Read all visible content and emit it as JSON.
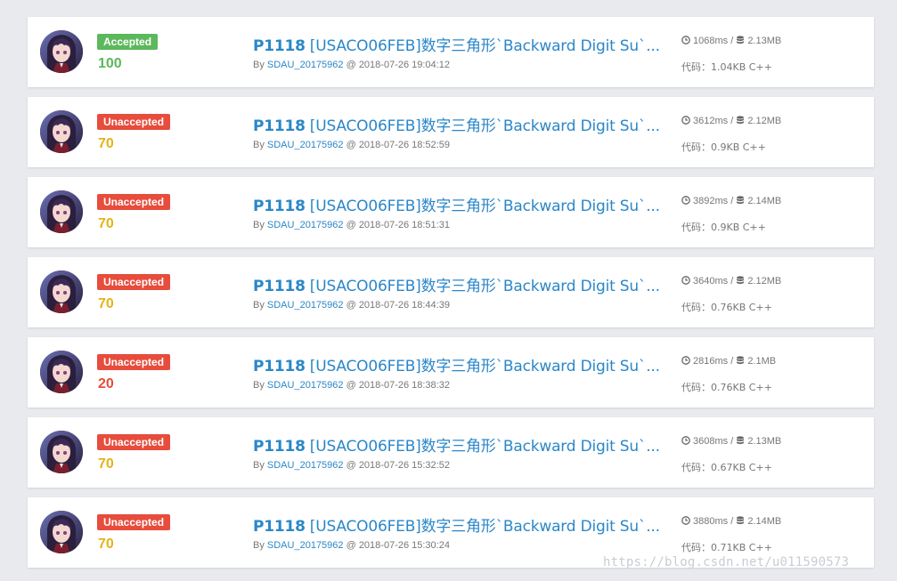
{
  "colors": {
    "accepted": "#5cb85c",
    "unaccepted": "#e74c3c",
    "score_full": "#5cb85c",
    "score_partial": "#e5b318",
    "score_low": "#e74c3c",
    "link": "#2b87c8"
  },
  "icons": {
    "time": "clock-icon",
    "memory": "database-icon"
  },
  "records": [
    {
      "status": "Accepted",
      "status_kind": "accepted",
      "score": "100",
      "score_kind": "full",
      "problem_id": "P1118",
      "problem_title": "[USACO06FEB]数字三角形`Backward Digit Su`...",
      "by": "By",
      "user": "SDAU_20175962",
      "at": "@ 2018-07-26 19:04:12",
      "time": "1068ms /",
      "memory": "2.13MB",
      "code": "代码：1.04KB C++"
    },
    {
      "status": "Unaccepted",
      "status_kind": "unaccepted",
      "score": "70",
      "score_kind": "partial",
      "problem_id": "P1118",
      "problem_title": "[USACO06FEB]数字三角形`Backward Digit Su`...",
      "by": "By",
      "user": "SDAU_20175962",
      "at": "@ 2018-07-26 18:52:59",
      "time": "3612ms /",
      "memory": "2.12MB",
      "code": "代码：0.9KB C++"
    },
    {
      "status": "Unaccepted",
      "status_kind": "unaccepted",
      "score": "70",
      "score_kind": "partial",
      "problem_id": "P1118",
      "problem_title": "[USACO06FEB]数字三角形`Backward Digit Su`...",
      "by": "By",
      "user": "SDAU_20175962",
      "at": "@ 2018-07-26 18:51:31",
      "time": "3892ms /",
      "memory": "2.14MB",
      "code": "代码：0.9KB C++"
    },
    {
      "status": "Unaccepted",
      "status_kind": "unaccepted",
      "score": "70",
      "score_kind": "partial",
      "problem_id": "P1118",
      "problem_title": "[USACO06FEB]数字三角形`Backward Digit Su`...",
      "by": "By",
      "user": "SDAU_20175962",
      "at": "@ 2018-07-26 18:44:39",
      "time": "3640ms /",
      "memory": "2.12MB",
      "code": "代码：0.76KB C++"
    },
    {
      "status": "Unaccepted",
      "status_kind": "unaccepted",
      "score": "20",
      "score_kind": "low",
      "problem_id": "P1118",
      "problem_title": "[USACO06FEB]数字三角形`Backward Digit Su`...",
      "by": "By",
      "user": "SDAU_20175962",
      "at": "@ 2018-07-26 18:38:32",
      "time": "2816ms /",
      "memory": "2.1MB",
      "code": "代码：0.76KB C++"
    },
    {
      "status": "Unaccepted",
      "status_kind": "unaccepted",
      "score": "70",
      "score_kind": "partial",
      "problem_id": "P1118",
      "problem_title": "[USACO06FEB]数字三角形`Backward Digit Su`...",
      "by": "By",
      "user": "SDAU_20175962",
      "at": "@ 2018-07-26 15:32:52",
      "time": "3608ms /",
      "memory": "2.13MB",
      "code": "代码：0.67KB C++"
    },
    {
      "status": "Unaccepted",
      "status_kind": "unaccepted",
      "score": "70",
      "score_kind": "partial",
      "problem_id": "P1118",
      "problem_title": "[USACO06FEB]数字三角形`Backward Digit Su`...",
      "by": "By",
      "user": "SDAU_20175962",
      "at": "@ 2018-07-26 15:30:24",
      "time": "3880ms /",
      "memory": "2.14MB",
      "code": "代码：0.71KB C++"
    }
  ],
  "watermark": "https://blog.csdn.net/u011590573"
}
